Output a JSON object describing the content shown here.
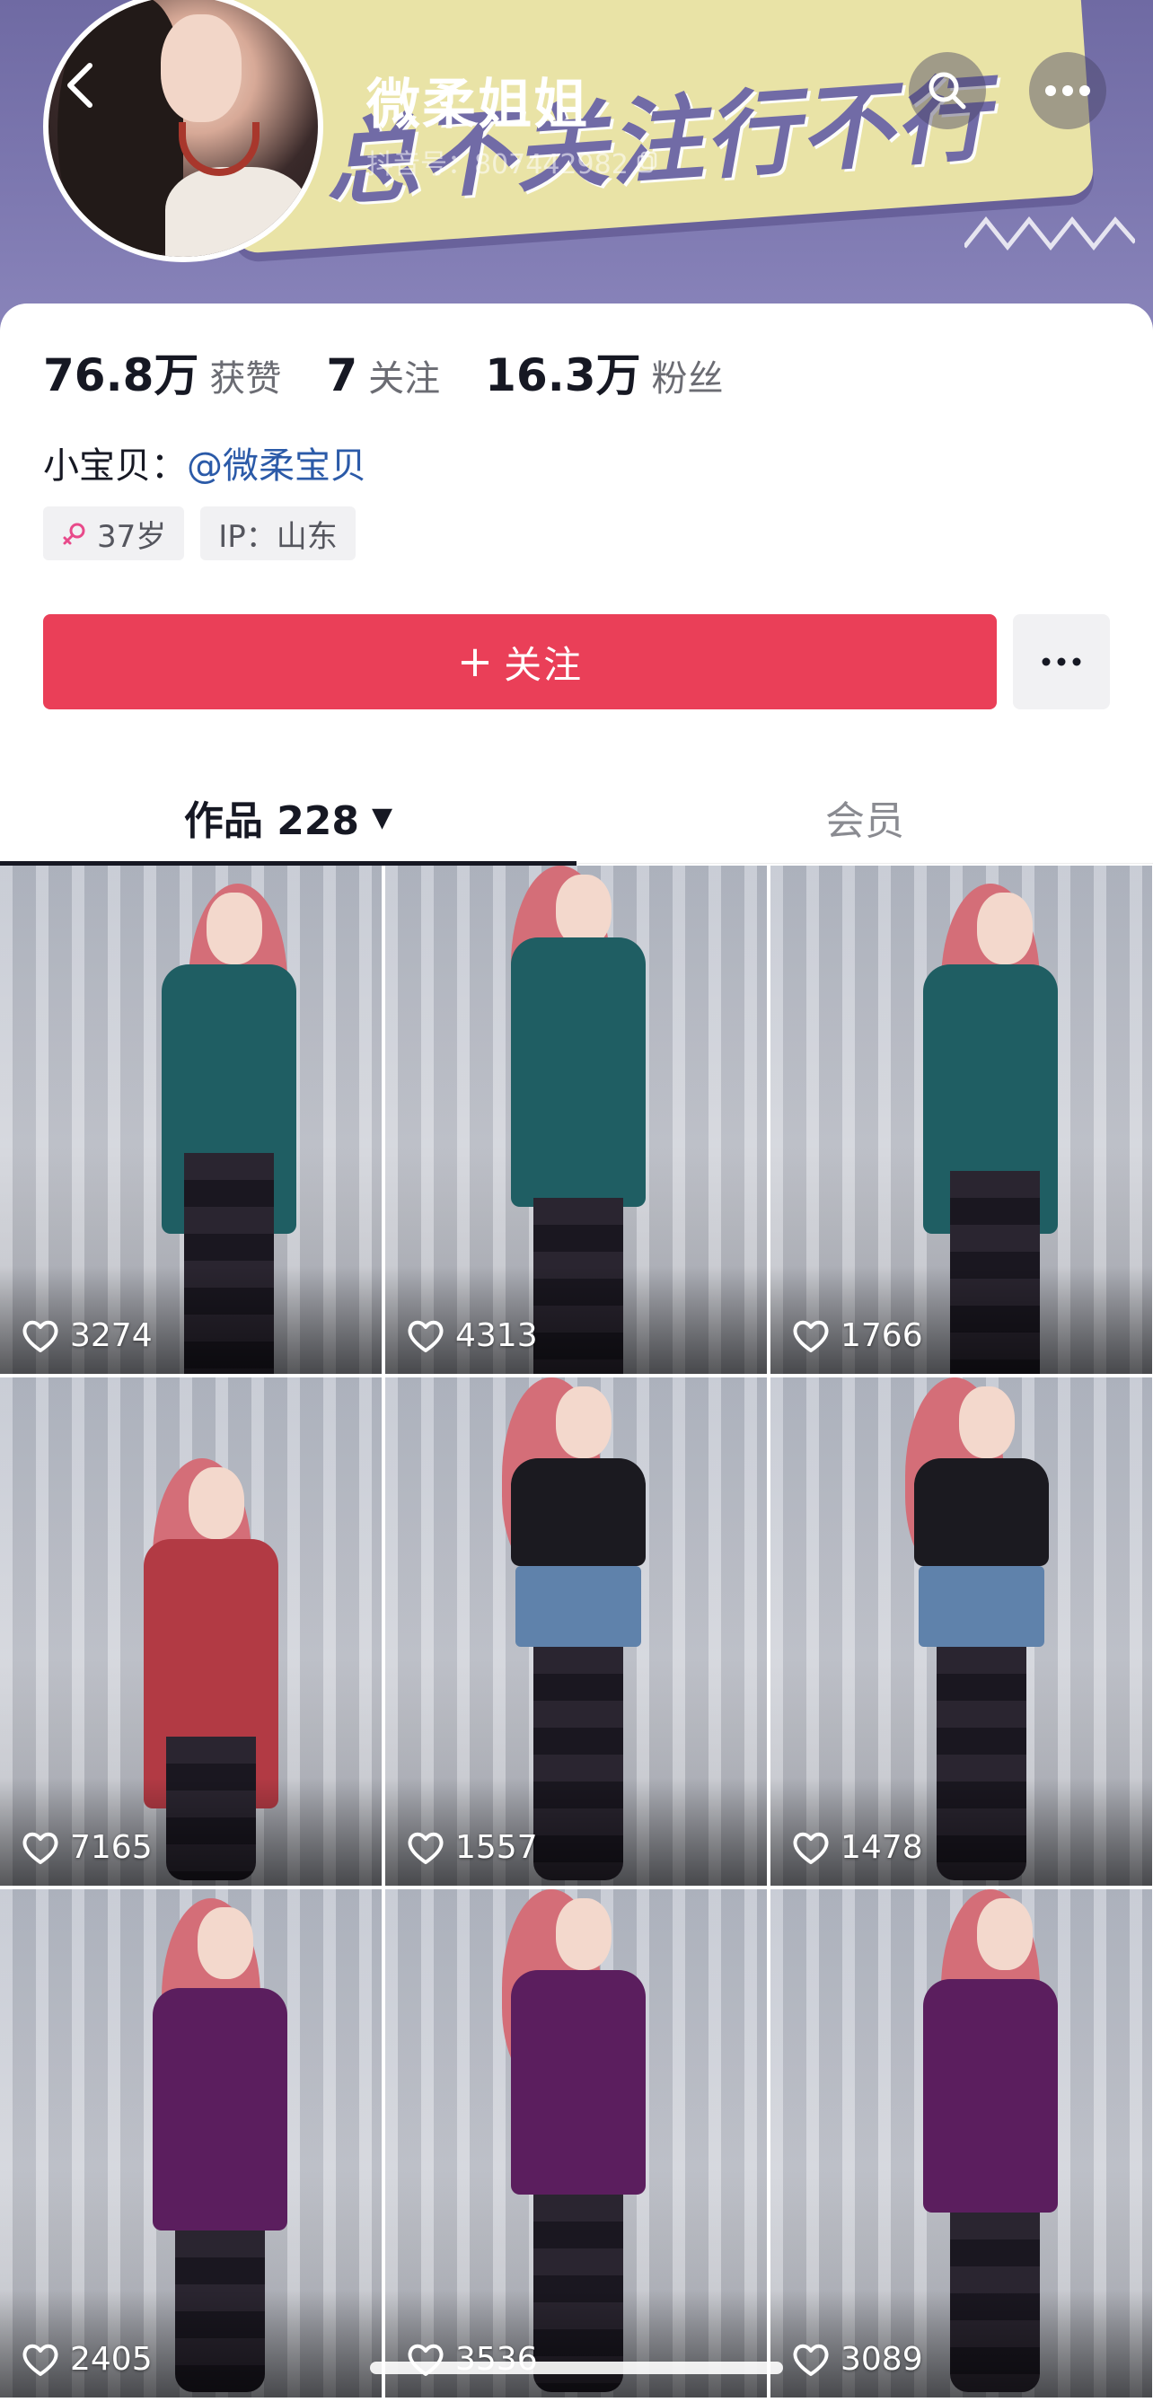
{
  "banner": {
    "slogan": "总不关注行不行"
  },
  "header": {
    "nickname": "微柔姐姐",
    "douyin_id": "抖音号：807442982"
  },
  "stats": [
    {
      "value": "76.8万",
      "label": "获赞"
    },
    {
      "value": "7",
      "label": "关注"
    },
    {
      "value": "16.3万",
      "label": "粉丝"
    }
  ],
  "bio": {
    "prefix": "小宝贝：",
    "mention": "@微柔宝贝"
  },
  "tags": {
    "age": "37岁",
    "ip": "IP：山东"
  },
  "actions": {
    "follow_plus": "+",
    "follow_label": "关注"
  },
  "tabs": {
    "works": "作品 228",
    "works_caret": "▼",
    "member": "会员"
  },
  "videos": [
    {
      "likes": "3274"
    },
    {
      "likes": "4313"
    },
    {
      "likes": "1766"
    },
    {
      "likes": "7165"
    },
    {
      "likes": "1557"
    },
    {
      "likes": "1478"
    },
    {
      "likes": "2405"
    },
    {
      "likes": "3536"
    },
    {
      "likes": "3089"
    }
  ],
  "colors": {
    "accent": "#ea3f58",
    "mention": "#2b5aa8",
    "gender": "#e84a8a",
    "dress_teal": "#1f5e63",
    "dress_red": "#b23a44",
    "dress_denim": "#5f82ab",
    "dress_purple": "#5b1e5e"
  },
  "icons": [
    "back-arrow-icon",
    "search-icon",
    "more-dots-icon",
    "copy-icon",
    "female-icon",
    "heart-icon"
  ]
}
